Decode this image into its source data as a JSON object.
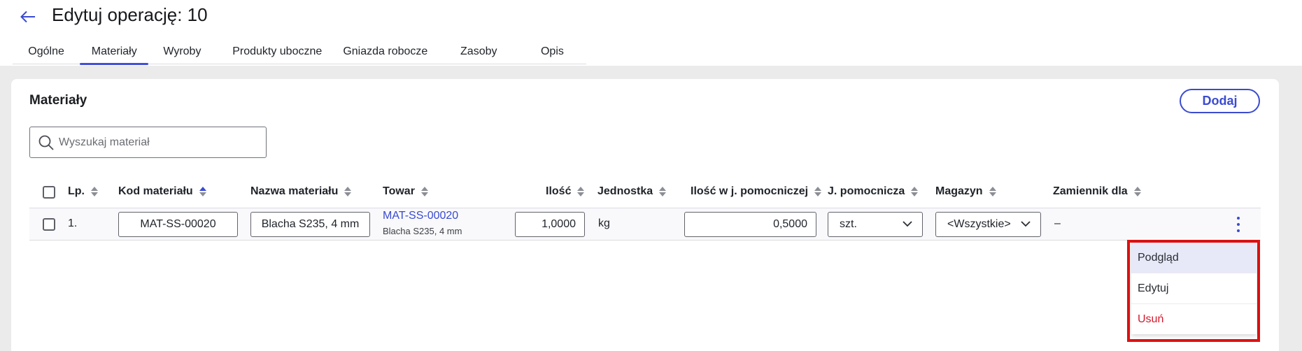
{
  "header": {
    "title": "Edytuj operację: 10",
    "back_icon": "arrow-left-icon"
  },
  "tabs": [
    {
      "label": "Ogólne",
      "active": false
    },
    {
      "label": "Materiały",
      "active": true
    },
    {
      "label": "Wyroby",
      "active": false
    },
    {
      "label": "Produkty uboczne",
      "active": false
    },
    {
      "label": "Gniazda robocze",
      "active": false
    },
    {
      "label": "Zasoby",
      "active": false
    },
    {
      "label": "Opis",
      "active": false
    }
  ],
  "section": {
    "title": "Materiały",
    "add_label": "Dodaj"
  },
  "search": {
    "placeholder": "Wyszukaj materiał",
    "value": ""
  },
  "table": {
    "columns": [
      {
        "label": "Lp.",
        "sort": "none"
      },
      {
        "label": "Kod materiału",
        "sort": "asc"
      },
      {
        "label": "Nazwa materiału",
        "sort": "none"
      },
      {
        "label": "Towar",
        "sort": "none"
      },
      {
        "label": "Ilość",
        "sort": "none"
      },
      {
        "label": "Jednostka",
        "sort": "none"
      },
      {
        "label": "Ilość w j. pomocniczej",
        "sort": "none"
      },
      {
        "label": "J. pomocnicza",
        "sort": "none"
      },
      {
        "label": "Magazyn",
        "sort": "none"
      },
      {
        "label": "Zamiennik dla",
        "sort": "none"
      }
    ],
    "rows": [
      {
        "lp": "1.",
        "kod": "MAT-SS-00020",
        "nazwa": "Blacha S235, 4 mm",
        "towar_code": "MAT-SS-00020",
        "towar_name": "Blacha S235, 4 mm",
        "ilosc": "1,0000",
        "jednostka": "kg",
        "ilosc_pom": "0,5000",
        "j_pom": "szt.",
        "magazyn": "<Wszystkie>",
        "zamiennik": "–"
      }
    ]
  },
  "context_menu": {
    "items": [
      {
        "label": "Podgląd",
        "state": "hover"
      },
      {
        "label": "Edytuj",
        "state": "normal"
      },
      {
        "label": "Usuń",
        "state": "danger"
      }
    ]
  },
  "colors": {
    "accent": "#3a4bd0",
    "danger": "#d5182a",
    "highlight_box": "#e01111",
    "page_bg": "#ebebeb"
  }
}
